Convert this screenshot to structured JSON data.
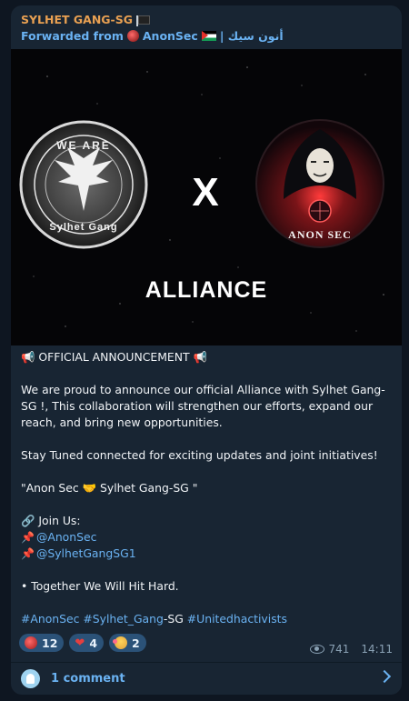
{
  "header": {
    "channel_name": "SYLHET GANG-SG",
    "forwarded_prefix": "Forwarded from",
    "forwarded_name": "AnonSec",
    "forwarded_suffix": "| أنون سيك"
  },
  "media": {
    "left_logo_top": "WE ARE",
    "left_logo_bottom": "Sylhet Gang",
    "cross": "X",
    "right_logo_text": "ANON SEC",
    "caption": "ALLIANCE"
  },
  "post": {
    "heading": "OFFICIAL ANNOUNCEMENT",
    "paragraph1": "We are proud to announce our official Alliance with Sylhet Gang-SG !, This collaboration will strengthen our efforts, expand our reach, and bring new opportunities.",
    "paragraph2": "Stay Tuned connected for exciting updates and joint initiatives!",
    "quote_left": "\"Anon Sec",
    "quote_right": "Sylhet Gang-SG \"",
    "join_label": "Join Us:",
    "handle1": "@AnonSec",
    "handle2": "@SylhetGangSG1",
    "slogan": "• Together We Will Hit Hard.",
    "tag1": "#AnonSec",
    "tag2": "#Sylhet_Gang",
    "tag2_suffix": "-SG",
    "tag3": "#Unitedhactivists"
  },
  "reactions": [
    {
      "icon": "bomb-icon",
      "count": "12"
    },
    {
      "icon": "heart-icon",
      "count": "4"
    },
    {
      "icon": "hearts-face-icon",
      "count": "2"
    }
  ],
  "meta": {
    "views": "741",
    "time": "14:11"
  },
  "comments": {
    "label": "1 comment"
  },
  "colors": {
    "background": "#0e1621",
    "bubble": "#182533",
    "accent_link": "#6ab2f2",
    "channel_name": "#e8a052",
    "reaction_bg": "#2b5278"
  }
}
